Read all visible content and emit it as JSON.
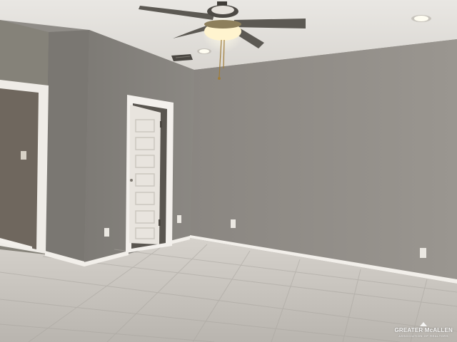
{
  "image": {
    "kind": "photo",
    "subject": "empty-room-interior"
  },
  "watermark": {
    "line1": "GREATER McALLEN",
    "line2": "ASSOCIATION OF REALTORS"
  },
  "colors": {
    "wall": "#8e8a85",
    "ceiling": "#e8e6e2",
    "floor": "#c9c5c0",
    "door": "#e9e6e1",
    "trim": "#f4f2ee"
  },
  "icons": [
    "ceiling-fan-icon",
    "light-fixture-icon",
    "outlet-icon",
    "vent-icon"
  ]
}
